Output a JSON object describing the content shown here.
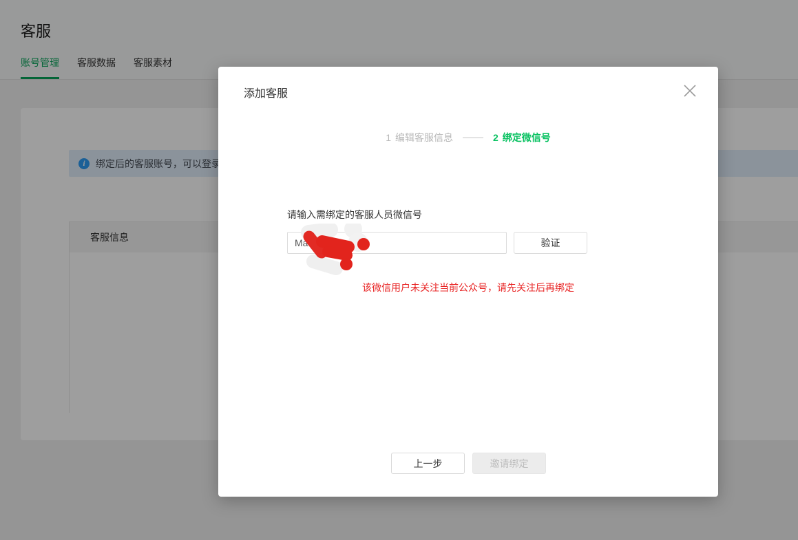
{
  "page": {
    "title": "客服",
    "tabs": [
      {
        "label": "账号管理",
        "active": true
      },
      {
        "label": "客服数据",
        "active": false
      },
      {
        "label": "客服素材",
        "active": false
      }
    ],
    "info_bar": {
      "icon": "info-icon",
      "icon_glyph": "i",
      "text": "绑定后的客服账号，可以登录"
    },
    "table": {
      "header_label": "客服信息",
      "rows": []
    }
  },
  "modal": {
    "title": "添加客服",
    "close_icon": "close-x-icon",
    "steps": [
      {
        "num": "1",
        "label": "编辑客服信息",
        "active": false
      },
      {
        "num": "2",
        "label": "绑定微信号",
        "active": true
      }
    ],
    "form": {
      "label": "请输入需绑定的客服人员微信号",
      "input_value": "Ma",
      "verify_button": "验证",
      "error_message": "该微信用户未关注当前公众号，请先关注后再绑定"
    },
    "footer": {
      "prev_button": "上一步",
      "invite_button": "邀请绑定",
      "invite_disabled": true
    }
  },
  "colors": {
    "accent_green": "#07c160",
    "tab_green": "#07a35a",
    "error_red": "#e82323",
    "redaction_red": "#e2241d",
    "info_blue": "#2d9cf4",
    "info_bar_bg": "#e1edfb",
    "overlay": "rgba(0,0,0,0.38)"
  }
}
